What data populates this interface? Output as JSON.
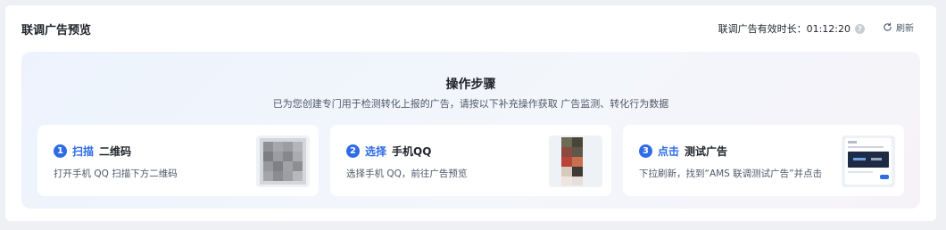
{
  "header": {
    "title": "联调广告预览",
    "validity_label": "联调广告有效时长：01:12:20",
    "refresh_label": "刷新"
  },
  "guide": {
    "title": "操作步骤",
    "subtitle": "已为您创建专门用于检测转化上报的广告，请按以下补充操作获取 广告监测、转化行为数据",
    "steps": [
      {
        "num": "1",
        "verb": "扫描",
        "obj": "二维码",
        "desc": "打开手机 QQ 扫描下方二维码",
        "thumb_icon": "qr-code-icon"
      },
      {
        "num": "2",
        "verb": "选择",
        "obj": "手机QQ",
        "desc": "选择手机 QQ，前往广告预览",
        "thumb_icon": "phone-qq-icon"
      },
      {
        "num": "3",
        "verb": "点击",
        "obj": "测试广告",
        "desc": "下拉刷新，找到“AMS 联调测试广告”并点击",
        "thumb_icon": "test-ad-preview-icon"
      }
    ]
  },
  "colors": {
    "accent": "#2e6be6",
    "text_primary": "#1f2329",
    "text_secondary": "#4e5969"
  }
}
